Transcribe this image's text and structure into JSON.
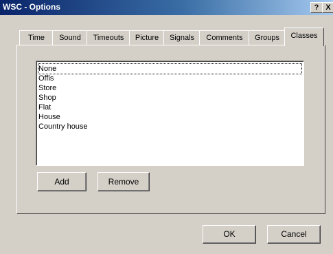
{
  "window": {
    "title": "WSC - Options",
    "help_glyph": "?",
    "close_glyph": "X"
  },
  "tabs": [
    {
      "label": "Time"
    },
    {
      "label": "Sound"
    },
    {
      "label": "Timeouts"
    },
    {
      "label": "Picture"
    },
    {
      "label": "Signals"
    },
    {
      "label": "Comments"
    },
    {
      "label": "Groups"
    },
    {
      "label": "Classes",
      "active": true
    }
  ],
  "classes_list": {
    "items": [
      "None",
      "Offis",
      "Store",
      "Shop",
      "Flat",
      "House",
      "Country house"
    ],
    "focused": "None"
  },
  "buttons": {
    "add": "Add",
    "remove": "Remove",
    "ok": "OK",
    "cancel": "Cancel"
  }
}
